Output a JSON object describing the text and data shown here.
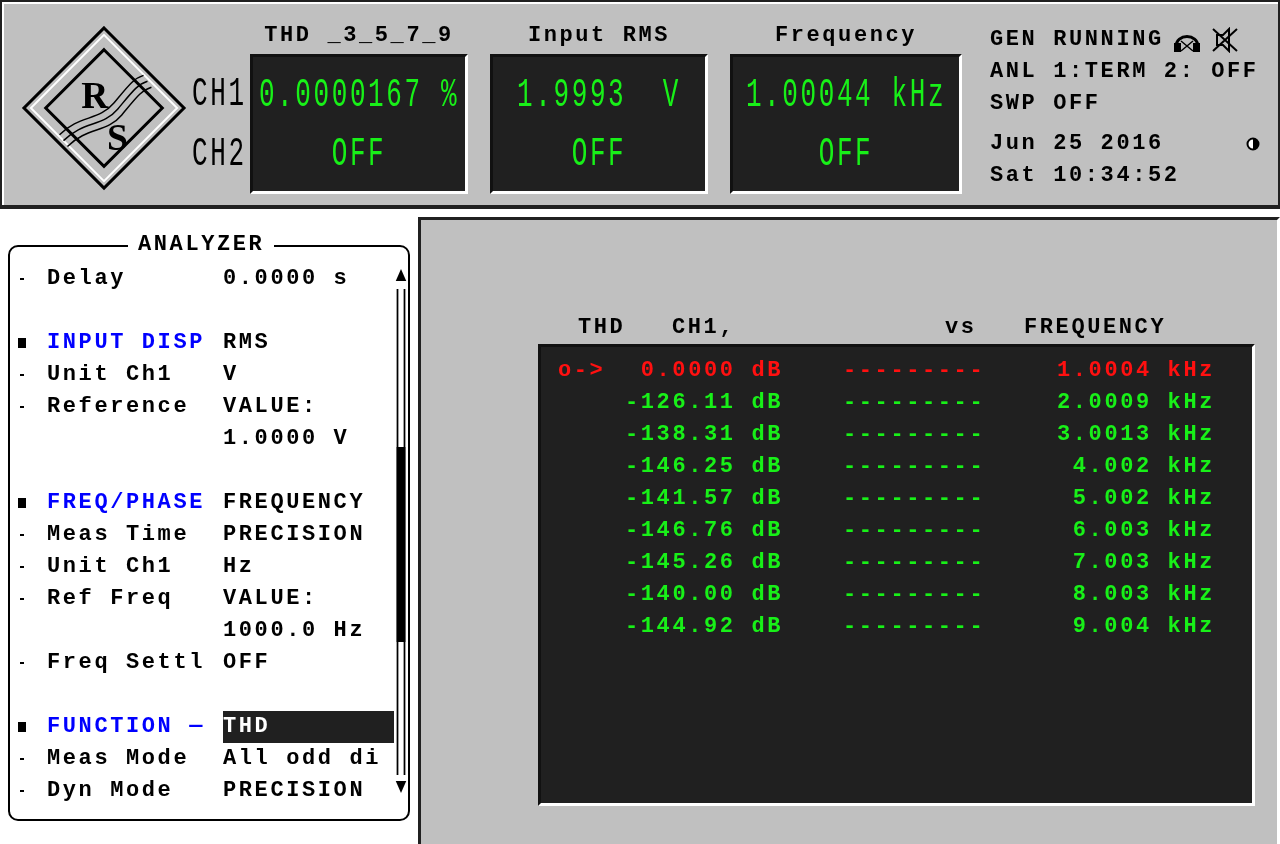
{
  "logo": {
    "letters": [
      "R",
      "S"
    ]
  },
  "channel_labels": [
    "CH1",
    "CH2"
  ],
  "displays": [
    {
      "title": "THD _3_5_7_9",
      "ch1": "0.0000167 %",
      "ch2": "OFF"
    },
    {
      "title": "Input RMS",
      "ch1": "1.9993  V",
      "ch2": "OFF"
    },
    {
      "title": "Frequency",
      "ch1": "1.00044 kHz",
      "ch2": "OFF"
    }
  ],
  "status": {
    "lines": [
      "GEN RUNNING",
      "ANL 1:TERM 2: OFF",
      "SWP OFF"
    ],
    "date": "Jun 25 2016",
    "time": "Sat 10:34:52"
  },
  "analyzer": {
    "title": "ANALYZER",
    "items": [
      {
        "kind": "param",
        "label": "Delay",
        "values": [
          "0.0000 s"
        ],
        "selected": false
      },
      {
        "kind": "section",
        "label": "INPUT DISP",
        "values": [
          "RMS"
        ],
        "selected": false
      },
      {
        "kind": "param",
        "label": "Unit Ch1",
        "values": [
          "V"
        ],
        "selected": false
      },
      {
        "kind": "param",
        "label": "Reference",
        "values": [
          "VALUE:",
          "1.0000 V"
        ],
        "selected": false
      },
      {
        "kind": "section",
        "label": "FREQ/PHASE",
        "values": [
          "FREQUENCY"
        ],
        "selected": false
      },
      {
        "kind": "param",
        "label": "Meas Time",
        "values": [
          "PRECISION"
        ],
        "selected": false
      },
      {
        "kind": "param",
        "label": "Unit Ch1",
        "values": [
          "Hz"
        ],
        "selected": false
      },
      {
        "kind": "param",
        "label": "Ref Freq",
        "values": [
          "VALUE:",
          "1000.0 Hz"
        ],
        "selected": false
      },
      {
        "kind": "param",
        "label": "Freq Settl",
        "values": [
          "OFF"
        ],
        "selected": false
      },
      {
        "kind": "section",
        "label": "FUNCTION —",
        "values": [
          "THD"
        ],
        "selected": true
      },
      {
        "kind": "param",
        "label": "Meas Mode",
        "values": [
          "All odd di"
        ],
        "selected": false
      },
      {
        "kind": "param",
        "label": "Dyn Mode",
        "values": [
          "PRECISION"
        ],
        "selected": false
      }
    ]
  },
  "table": {
    "header": [
      "THD",
      "CH1,",
      "vs",
      "FREQUENCY"
    ],
    "rows": [
      {
        "selected": true,
        "marker": "o->",
        "value": "0.0000 dB",
        "dashes": "---------",
        "frequency": "1.0004 kHz"
      },
      {
        "selected": false,
        "value": "-126.11 dB",
        "dashes": "---------",
        "frequency": "2.0009 kHz"
      },
      {
        "selected": false,
        "value": "-138.31 dB",
        "dashes": "---------",
        "frequency": "3.0013 kHz"
      },
      {
        "selected": false,
        "value": "-146.25 dB",
        "dashes": "---------",
        "frequency": "4.002 kHz"
      },
      {
        "selected": false,
        "value": "-141.57 dB",
        "dashes": "---------",
        "frequency": "5.002 kHz"
      },
      {
        "selected": false,
        "value": "-146.76 dB",
        "dashes": "---------",
        "frequency": "6.003 kHz"
      },
      {
        "selected": false,
        "value": "-145.26 dB",
        "dashes": "---------",
        "frequency": "7.003 kHz"
      },
      {
        "selected": false,
        "value": "-140.00 dB",
        "dashes": "---------",
        "frequency": "8.003 kHz"
      },
      {
        "selected": false,
        "value": "-144.92 dB",
        "dashes": "---------",
        "frequency": "9.004 kHz"
      }
    ]
  }
}
